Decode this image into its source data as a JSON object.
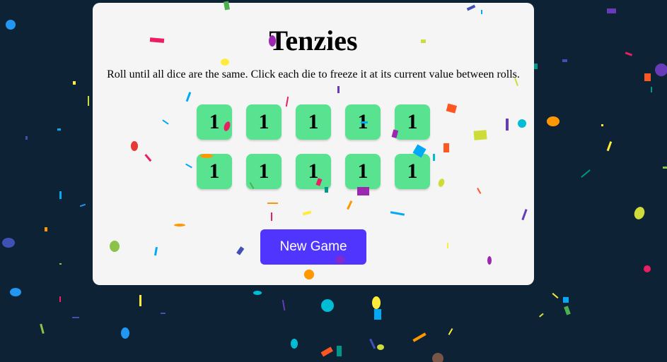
{
  "game": {
    "title": "Tenzies",
    "instructions": "Roll until all dice are the same. Click each die to freeze it at its current value between rolls.",
    "dice": [
      {
        "value": "1",
        "held": true
      },
      {
        "value": "1",
        "held": true
      },
      {
        "value": "1",
        "held": true
      },
      {
        "value": "1",
        "held": true
      },
      {
        "value": "1",
        "held": true
      },
      {
        "value": "1",
        "held": true
      },
      {
        "value": "1",
        "held": true
      },
      {
        "value": "1",
        "held": true
      },
      {
        "value": "1",
        "held": true
      },
      {
        "value": "1",
        "held": true
      }
    ],
    "new_game_label": "New Game"
  },
  "colors": {
    "background": "#0d2235",
    "card": "#f5f5f5",
    "die_held": "#59e391",
    "button": "#5035ff",
    "confetti": [
      "#e91e63",
      "#2196f3",
      "#ff9800",
      "#cddc39",
      "#673ab7",
      "#00bcd4",
      "#ff5722",
      "#8bc34a",
      "#ffeb3b",
      "#3f51b5",
      "#9c27b0",
      "#03a9f4",
      "#009688",
      "#795548",
      "#4caf50"
    ]
  }
}
